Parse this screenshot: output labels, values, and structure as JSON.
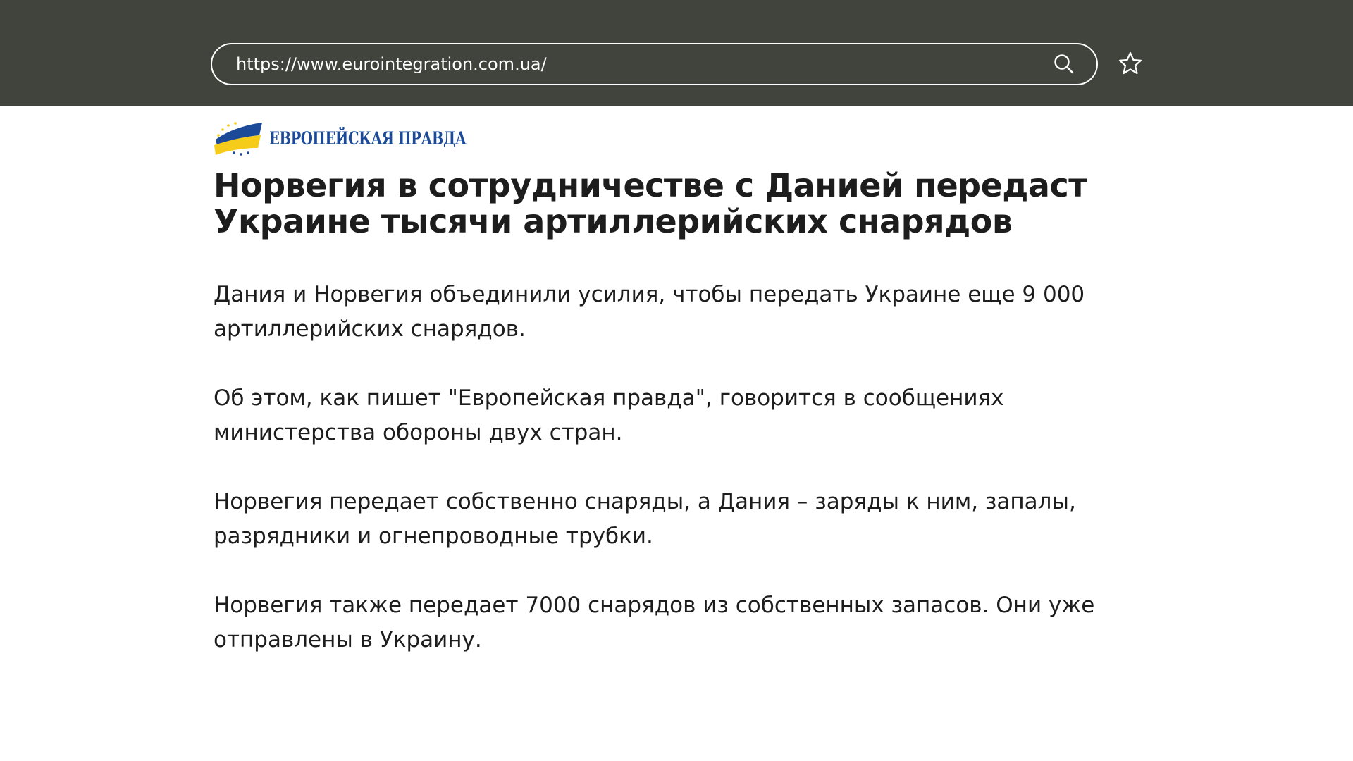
{
  "browser": {
    "url": "https://www.eurointegration.com.ua/"
  },
  "site": {
    "logo_text": "ЕВРОПЕЙСКАЯ ПРАВДА",
    "brand_blue": "#1c4a99",
    "brand_yellow": "#f5cc1a"
  },
  "article": {
    "headline": "Норвегия в сотрудничестве с Данией передаст Украине тысячи артиллерийских снарядов",
    "paragraphs": [
      "Дания и Норвегия объединили усилия, чтобы передать Украине еще 9 000 артиллерийских снарядов.",
      "Об этом, как пишет \"Европейская правда\", говорится в сообщениях министерства обороны двух стран.",
      "Норвегия передает собственно снаряды, а Дания – заряды к ним, запалы, разрядники и огнепроводные трубки.",
      "Норвегия также передает 7000 снарядов из собственных запасов. Они уже отправлены в Украину."
    ]
  },
  "icons": {
    "search": "search-icon",
    "bookmark": "star-icon"
  },
  "colors": {
    "topbar": "#40443d",
    "text": "#1d1d1d"
  }
}
